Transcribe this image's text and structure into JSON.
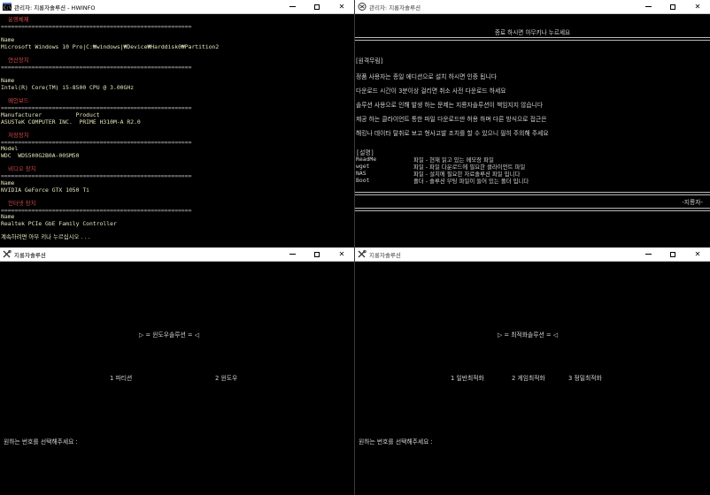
{
  "win1": {
    "title": "관리자:  지룡자솔루션 - HWINFO",
    "lines": [
      {
        "t": "    운영체제",
        "c": "hdr"
      },
      {
        "t": "========================================================",
        "c": "sep"
      },
      {
        "t": "",
        "c": ""
      },
      {
        "t": "Name",
        "c": "yl"
      },
      {
        "t": "Microsoft Windows 10 Pro|C:₩windows|₩Device₩Harddisk0₩Partition2",
        "c": "yl"
      },
      {
        "t": "",
        "c": ""
      },
      {
        "t": "    연산장치",
        "c": "hdr"
      },
      {
        "t": "========================================================",
        "c": "sep"
      },
      {
        "t": "",
        "c": ""
      },
      {
        "t": "Name",
        "c": "yl"
      },
      {
        "t": "Intel(R) Core(TM) i5-8500 CPU @ 3.00GHz",
        "c": "yl"
      },
      {
        "t": "",
        "c": ""
      },
      {
        "t": "    메인보드",
        "c": "hdr"
      },
      {
        "t": "========================================================",
        "c": "sep"
      },
      {
        "t": "Manufacturer          Product",
        "c": "yl"
      },
      {
        "t": "ASUSTeK COMPUTER INC.  PRIME H310M-A R2.0",
        "c": "yl"
      },
      {
        "t": "",
        "c": ""
      },
      {
        "t": "    저장장치",
        "c": "hdr"
      },
      {
        "t": "========================================================",
        "c": "sep"
      },
      {
        "t": "Model",
        "c": "yl"
      },
      {
        "t": "WDC  WDS500G2B0A-00SM50",
        "c": "yl"
      },
      {
        "t": "",
        "c": ""
      },
      {
        "t": "    비디오 장치",
        "c": "hdr"
      },
      {
        "t": "========================================================",
        "c": "sep"
      },
      {
        "t": "Name",
        "c": "yl"
      },
      {
        "t": "NVIDIA GeForce GTX 1050 Ti",
        "c": "yl"
      },
      {
        "t": "",
        "c": ""
      },
      {
        "t": "    인터넷 장치",
        "c": "hdr"
      },
      {
        "t": "========================================================",
        "c": "sep"
      },
      {
        "t": "Name",
        "c": "yl"
      },
      {
        "t": "Realtek PCIe GbE Family Controller",
        "c": "yl"
      },
      {
        "t": "",
        "c": ""
      },
      {
        "t": "계속하려면 아무 키나 누르십시오 . . .",
        "c": "yl"
      }
    ]
  },
  "win2": {
    "title": "관리자:  지룡자솔루션",
    "prompt": "종료 하시면 아무키나 누르세요",
    "notice_header": "[원격무림]",
    "notice_lines": [
      "정품 사용자는 종일 에디션으로 설치 하시면 인증 됩니다",
      "다운로드 시간이 3분이상 걸리면 취소 사전 다운로드 하세요",
      "솔루션 사용으로 인해 발생 하는 문제는 지룡자솔루션이 책임지지 않습니다",
      "제공 하는 클라이언트 통한 파일 다운로드만 허용 하며 다른 방식으로 접근은",
      "해킹나 데이타 탈취로 보고 형사고발 조치를 할 수 있으니 필히 주의해 주세요"
    ],
    "desc_header": "[설명]",
    "desc_items": [
      {
        "name": "ReadMe",
        "desc": "파일 - 현재 읽고 있는 메모장 파일"
      },
      {
        "name": "wget",
        "desc": "파일 - 파일 다운로드에 필요한 클라이언트 파일"
      },
      {
        "name": "NAS",
        "desc": "파일 - 설치에 필요한 자료솔루션 파일 입니다"
      },
      {
        "name": "Boot",
        "desc": "폴더 - 솔루션 부팅 파일이 들어 있는 폴더 입니다"
      }
    ],
    "signature": "-지룡자-"
  },
  "win3": {
    "title": "지룡자솔루션",
    "menu_title": "▷ = 윈도우솔루션 = ◁",
    "options": [
      "1 파티션",
      "2 윈도우"
    ],
    "input_prompt": "원하는 번호를 선택해주세요 :"
  },
  "win4": {
    "title": "지룡자솔루션",
    "menu_title": "▷ = 최적화솔루션 = ◁",
    "options": [
      "1 일반최적화",
      "2 게임최적화",
      "3 정밀최적화"
    ],
    "input_prompt": "원하는 번호를 선택해주세요 :"
  },
  "controls": {
    "minimize": "—",
    "maximize": "□",
    "close": "✕"
  }
}
